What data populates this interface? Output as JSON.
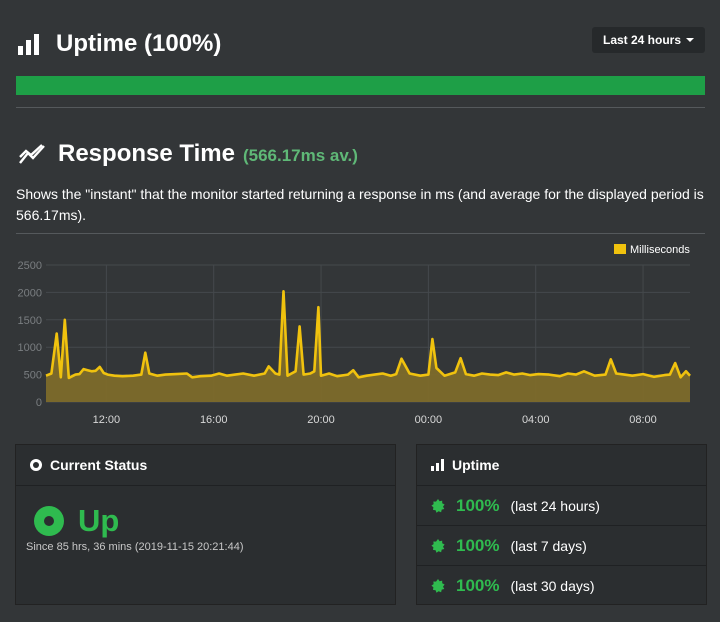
{
  "uptime": {
    "title": "Uptime (100%)",
    "range_button": "Last 24 hours",
    "bar_percent": 100,
    "bar_color": "#1e9f47"
  },
  "response_time": {
    "title": "Response Time",
    "average": "(566.17ms av.)",
    "description": "Shows the \"instant\" that the monitor started returning a response in ms (and average for the displayed period is 566.17ms)."
  },
  "chart_data": {
    "type": "area",
    "legend": [
      "Milliseconds"
    ],
    "legend_position": "top-right",
    "series_color": "#f0c20e",
    "ylim": [
      0,
      2500
    ],
    "y_ticks": [
      "0",
      "500",
      "1000",
      "1500",
      "2000",
      "2500"
    ],
    "x_ticks": [
      "12:00",
      "16:00",
      "20:00",
      "00:00",
      "04:00",
      "08:00"
    ],
    "x_tick_hours": [
      12,
      16,
      20,
      24,
      28,
      32
    ],
    "xlim_hours": [
      9.75,
      33.75
    ],
    "grid": true,
    "series": [
      {
        "name": "Milliseconds",
        "x_hours": [
          9.75,
          9.95,
          10.15,
          10.3,
          10.45,
          10.6,
          10.85,
          11.0,
          11.15,
          11.3,
          11.45,
          11.6,
          11.75,
          11.9,
          12.05,
          12.3,
          12.6,
          13.0,
          13.3,
          13.45,
          13.6,
          13.9,
          14.2,
          14.6,
          15.0,
          15.2,
          15.5,
          15.9,
          16.2,
          16.5,
          16.8,
          17.1,
          17.5,
          17.9,
          18.05,
          18.3,
          18.45,
          18.6,
          18.75,
          18.9,
          19.05,
          19.2,
          19.35,
          19.6,
          19.75,
          19.9,
          20.0,
          20.15,
          20.3,
          20.6,
          21.0,
          21.2,
          21.4,
          21.7,
          22.0,
          22.3,
          22.6,
          22.8,
          23.0,
          23.3,
          23.7,
          24.0,
          24.15,
          24.3,
          24.6,
          25.0,
          25.2,
          25.4,
          25.7,
          26.0,
          26.3,
          26.6,
          26.9,
          27.2,
          27.5,
          27.8,
          28.1,
          28.5,
          28.9,
          29.2,
          29.5,
          29.8,
          30.2,
          30.6,
          30.8,
          31.0,
          31.3,
          31.6,
          32.0,
          32.4,
          32.8,
          33.0,
          33.2,
          33.4,
          33.6,
          33.75
        ],
        "y": [
          480,
          520,
          1250,
          450,
          1500,
          440,
          500,
          510,
          600,
          580,
          560,
          570,
          640,
          530,
          500,
          480,
          470,
          480,
          500,
          900,
          520,
          480,
          500,
          510,
          520,
          450,
          470,
          480,
          520,
          480,
          500,
          520,
          480,
          520,
          650,
          520,
          500,
          2020,
          480,
          520,
          560,
          1380,
          500,
          520,
          560,
          1730,
          480,
          500,
          520,
          470,
          500,
          580,
          450,
          480,
          500,
          520,
          480,
          510,
          790,
          520,
          480,
          500,
          1150,
          620,
          480,
          540,
          800,
          510,
          480,
          520,
          500,
          490,
          540,
          500,
          520,
          490,
          510,
          500,
          470,
          520,
          500,
          560,
          480,
          500,
          780,
          520,
          500,
          480,
          510,
          460,
          490,
          500,
          710,
          450,
          560,
          480
        ]
      }
    ]
  },
  "current_status": {
    "title": "Current Status",
    "status": "Up",
    "since": "Since 85 hrs, 36 mins (2019-11-15 20:21:44)"
  },
  "uptime_panel": {
    "title": "Uptime",
    "rows": [
      {
        "pct": "100%",
        "period": "(last 24 hours)"
      },
      {
        "pct": "100%",
        "period": "(last 7 days)"
      },
      {
        "pct": "100%",
        "period": "(last 30 days)"
      }
    ]
  }
}
